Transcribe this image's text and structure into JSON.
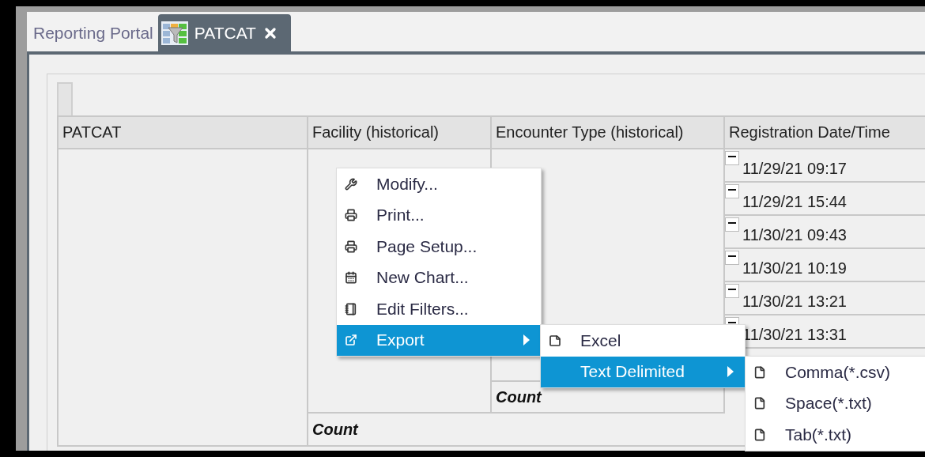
{
  "tabs": [
    {
      "label": "Reporting Portal",
      "selected": false,
      "closable": false
    },
    {
      "label": "PATCAT",
      "selected": true,
      "closable": true
    }
  ],
  "table": {
    "columns": [
      "PATCAT",
      "Facility (historical)",
      "Encounter Type (historical)",
      "Registration Date/Time"
    ],
    "rows": [
      {
        "date": "11/29/21 09:17",
        "expanded": true
      },
      {
        "date": "11/29/21 15:44",
        "expanded": true
      },
      {
        "date": "11/30/21 09:43",
        "expanded": true
      },
      {
        "date": "11/30/21 10:19",
        "expanded": true
      },
      {
        "date": "11/30/21 13:21",
        "expanded": true
      },
      {
        "date": "11/30/21 13:31",
        "expanded": true
      }
    ],
    "encounter_total_label": "Count",
    "facility_total_label": "Count"
  },
  "context_menu": {
    "items": [
      {
        "label": "Modify...",
        "selected": false
      },
      {
        "label": "Print...",
        "selected": false
      },
      {
        "label": "Page Setup...",
        "selected": false
      },
      {
        "label": "New Chart...",
        "selected": false
      },
      {
        "label": "Edit Filters...",
        "selected": false
      },
      {
        "label": "Export",
        "selected": true,
        "children": [
          {
            "label": "Excel",
            "selected": false
          },
          {
            "label": "Text Delimited",
            "selected": true,
            "children": [
              {
                "label": "Comma(*.csv)",
                "selected": false
              },
              {
                "label": "Space(*.txt)",
                "selected": false
              },
              {
                "label": "Tab(*.txt)",
                "selected": false
              }
            ]
          }
        ]
      }
    ]
  }
}
